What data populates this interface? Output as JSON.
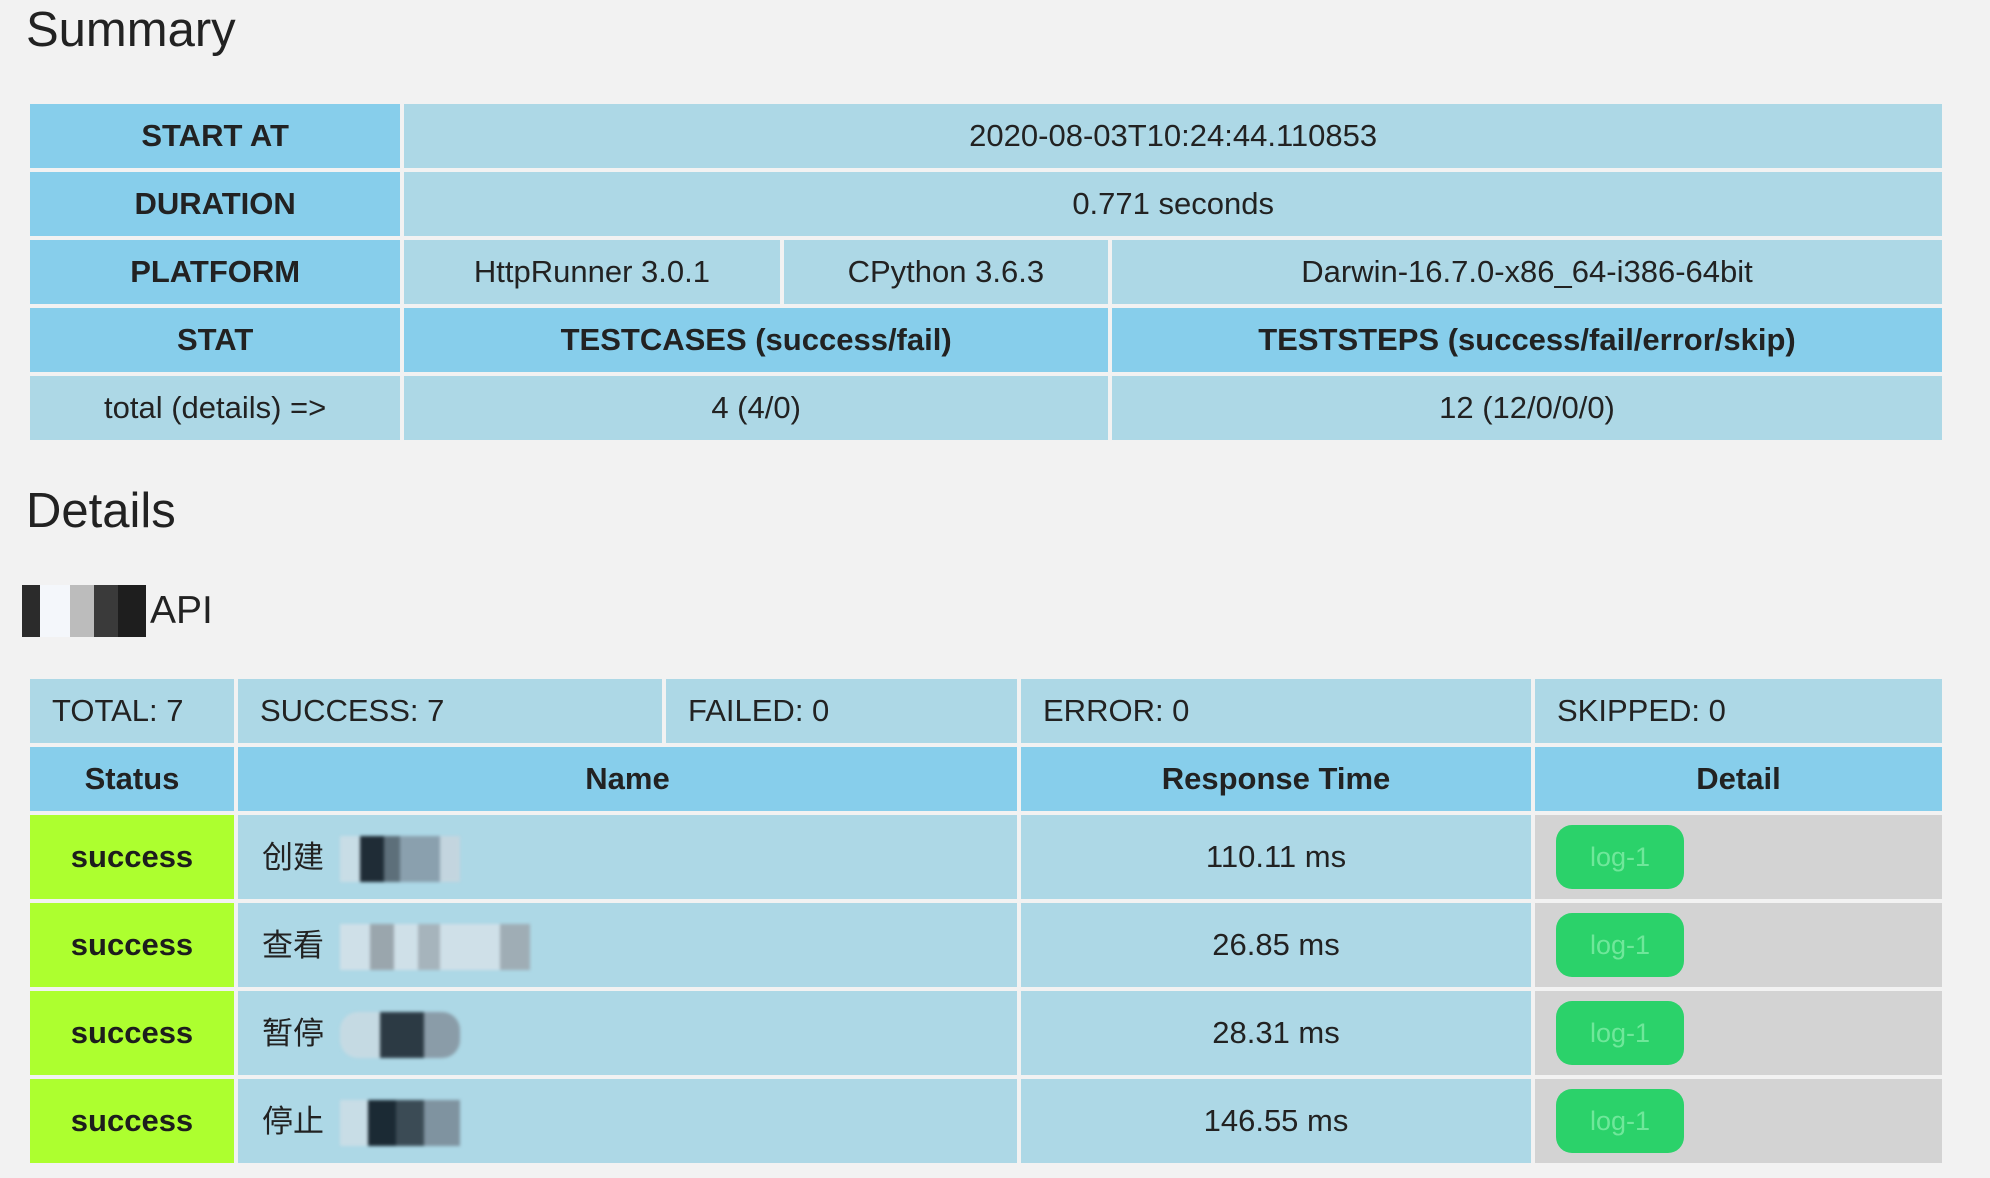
{
  "summary": {
    "heading": "Summary",
    "start_at_label": "START AT",
    "start_at_value": "2020-08-03T10:24:44.110853",
    "duration_label": "DURATION",
    "duration_value": "0.771 seconds",
    "platform_label": "PLATFORM",
    "platform_httprunner": "HttpRunner 3.0.1",
    "platform_python": "CPython 3.6.3",
    "platform_os": "Darwin-16.7.0-x86_64-i386-64bit",
    "stat_label": "STAT",
    "testcases_label": "TESTCASES (success/fail)",
    "teststeps_label": "TESTSTEPS (success/fail/error/skip)",
    "total_label": "total (details) =>",
    "testcases_value": "4 (4/0)",
    "teststeps_value": "12 (12/0/0/0)"
  },
  "details": {
    "heading": "Details",
    "suite_name": "API",
    "stats": {
      "total": "TOTAL: 7",
      "success": "SUCCESS: 7",
      "failed": "FAILED: 0",
      "error": "ERROR: 0",
      "skipped": "SKIPPED: 0"
    },
    "columns": {
      "status": "Status",
      "name": "Name",
      "response_time": "Response Time",
      "detail": "Detail"
    },
    "rows": [
      {
        "status": "success",
        "name": "创建",
        "response_time": "110.11 ms",
        "log": "log-1"
      },
      {
        "status": "success",
        "name": "查看",
        "response_time": "26.85 ms",
        "log": "log-1"
      },
      {
        "status": "success",
        "name": "暂停",
        "response_time": "28.31 ms",
        "log": "log-1"
      },
      {
        "status": "success",
        "name": "停止",
        "response_time": "146.55 ms",
        "log": "log-1"
      }
    ]
  },
  "colors": {
    "header_bg": "#87ceeb",
    "cell_bg": "#add8e6",
    "success_bg": "#adff2f",
    "detail_bg": "#d3d3d3",
    "log_button_bg": "#2bd26a"
  }
}
